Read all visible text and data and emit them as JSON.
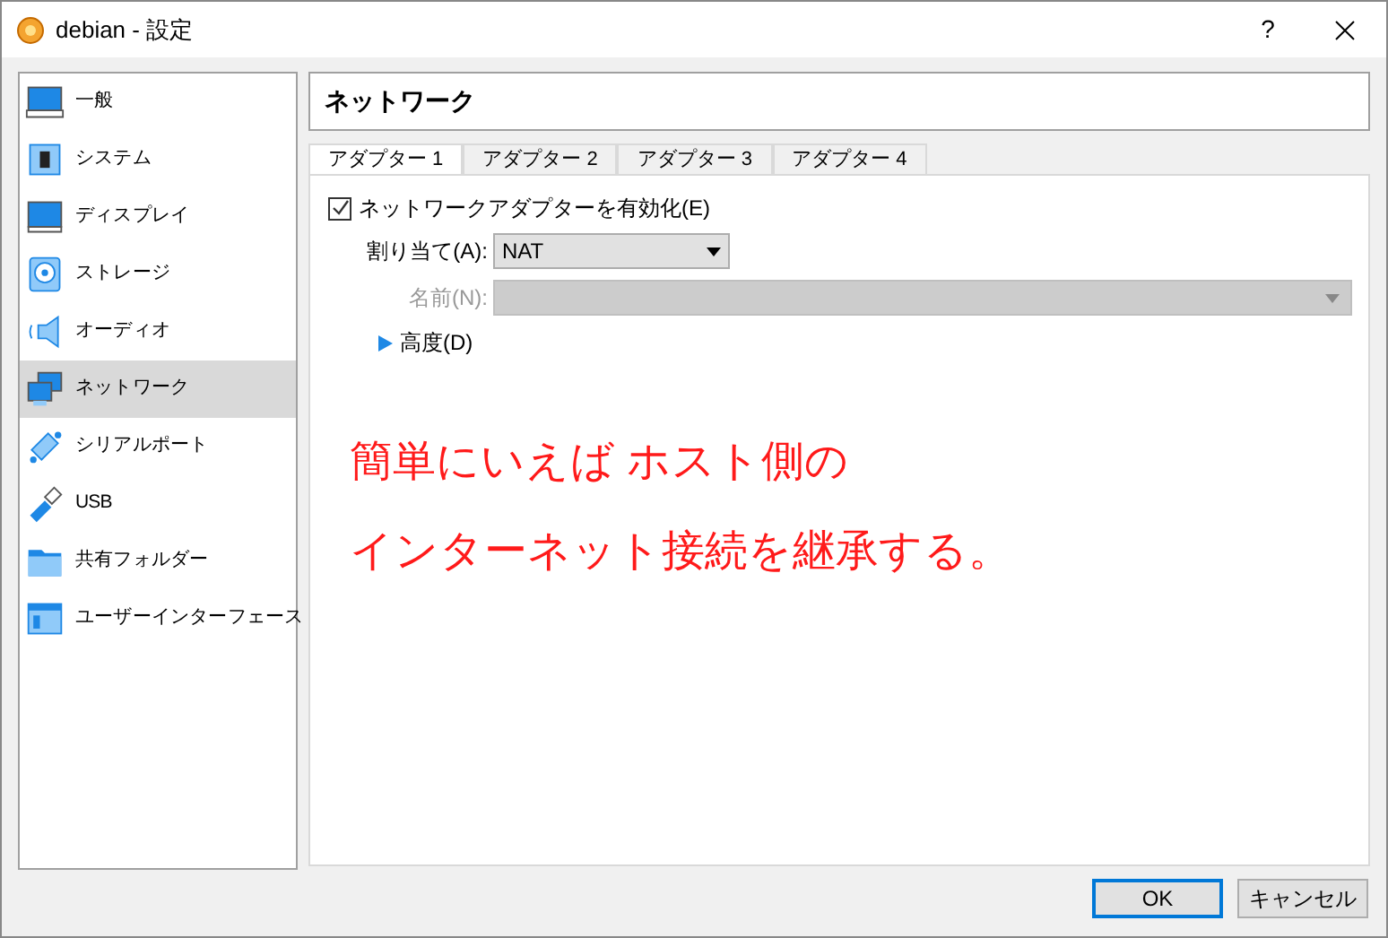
{
  "window": {
    "title": "debian - 設定",
    "help": "?"
  },
  "sidebar": {
    "items": [
      {
        "label": "一般",
        "selected": false
      },
      {
        "label": "システム",
        "selected": false
      },
      {
        "label": "ディスプレイ",
        "selected": false
      },
      {
        "label": "ストレージ",
        "selected": false
      },
      {
        "label": "オーディオ",
        "selected": false
      },
      {
        "label": "ネットワーク",
        "selected": true
      },
      {
        "label": "シリアルポート",
        "selected": false
      },
      {
        "label": "USB",
        "selected": false
      },
      {
        "label": "共有フォルダー",
        "selected": false
      },
      {
        "label": "ユーザーインターフェース",
        "selected": false
      }
    ]
  },
  "page_title": "ネットワーク",
  "tabs": [
    {
      "label": "アダプター 1",
      "selected": true
    },
    {
      "label": "アダプター 2",
      "selected": false
    },
    {
      "label": "アダプター 3",
      "selected": false
    },
    {
      "label": "アダプター 4",
      "selected": false
    }
  ],
  "enable_adapter": {
    "label": "ネットワークアダプターを有効化(E)",
    "checked": true
  },
  "attached_to": {
    "label": "割り当て(A):",
    "value": "NAT",
    "disabled": false
  },
  "name": {
    "label": "名前(N):",
    "disabled": true
  },
  "advanced": {
    "label": "高度(D)",
    "expanded": false
  },
  "annotation": [
    "簡単にいえば ホスト側の",
    "インターネット接続を継承する。"
  ],
  "buttons": [
    {
      "label": "OK",
      "default": true
    },
    {
      "label": "キャンセル",
      "default": false
    }
  ]
}
